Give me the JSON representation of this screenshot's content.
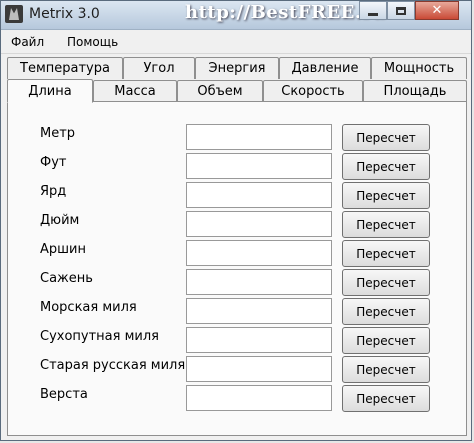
{
  "window": {
    "title": "Metrix 3.0",
    "watermark": "http://BestFREE.ru",
    "close_glyph": "✕"
  },
  "menu": [
    "Файл",
    "Помощь"
  ],
  "tabs_row1": [
    "Температура",
    "Угол",
    "Энергия",
    "Давление",
    "Мощность"
  ],
  "tabs_row2": [
    "Длина",
    "Масса",
    "Объем",
    "Скорость",
    "Площадь"
  ],
  "active_tab": "Длина",
  "rows": [
    {
      "label": "Метр",
      "value": "",
      "button": "Пересчет"
    },
    {
      "label": "Фут",
      "value": "",
      "button": "Пересчет"
    },
    {
      "label": "Ярд",
      "value": "",
      "button": "Пересчет"
    },
    {
      "label": "Дюйм",
      "value": "",
      "button": "Пересчет"
    },
    {
      "label": "Аршин",
      "value": "",
      "button": "Пересчет"
    },
    {
      "label": "Сажень",
      "value": "",
      "button": "Пересчет"
    },
    {
      "label": "Морская миля",
      "value": "",
      "button": "Пересчет"
    },
    {
      "label": "Сухопутная миля",
      "value": "",
      "button": "Пересчет"
    },
    {
      "label": "Старая русская миля",
      "value": "",
      "button": "Пересчет"
    },
    {
      "label": "Верста",
      "value": "",
      "button": "Пересчет"
    }
  ]
}
